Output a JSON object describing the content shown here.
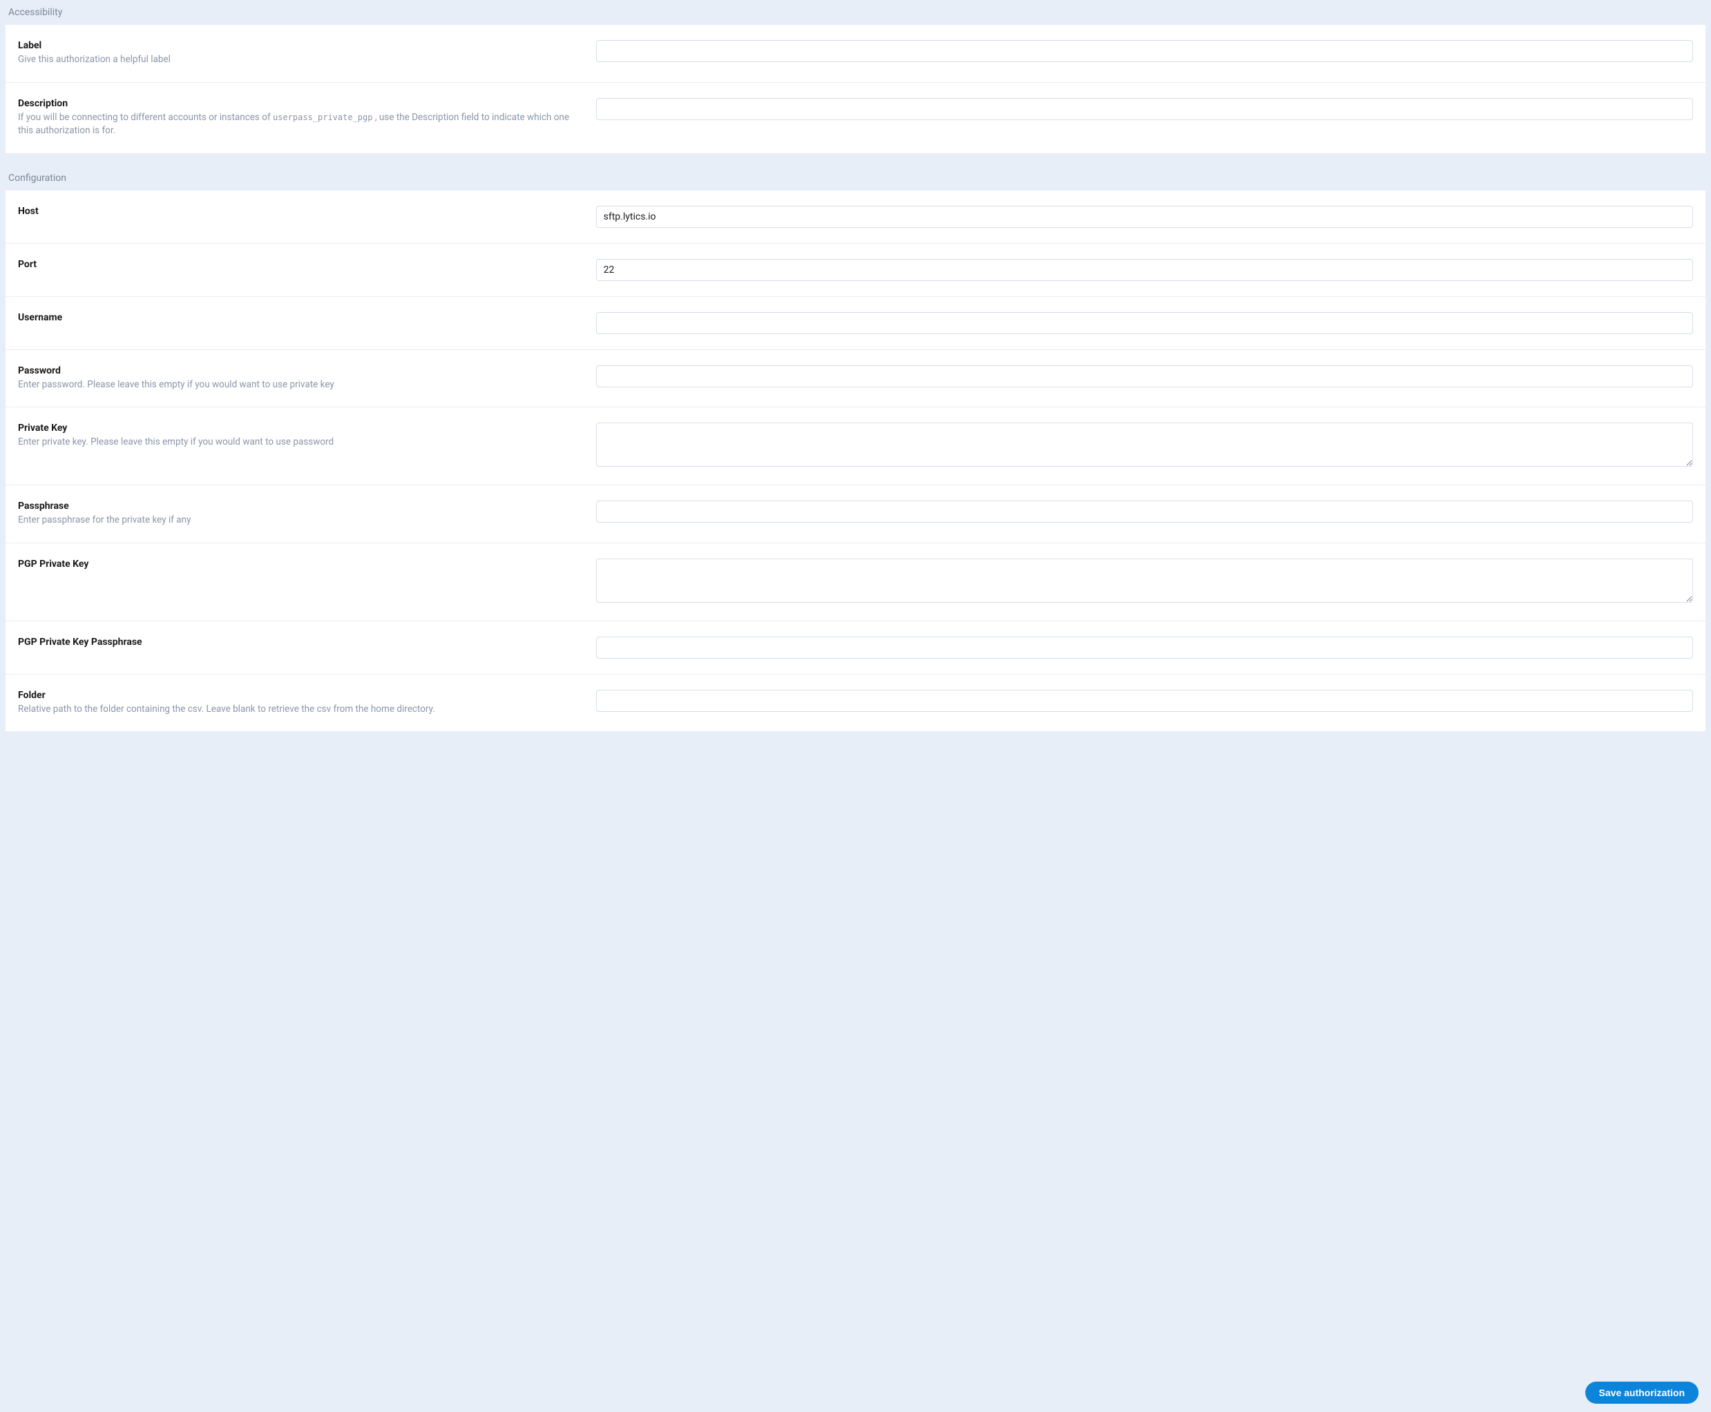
{
  "sections": {
    "accessibility": {
      "title": "Accessibility",
      "label": {
        "label": "Label",
        "help": "Give this authorization a helpful label",
        "value": ""
      },
      "description": {
        "label": "Description",
        "help_prefix": "If you will be connecting to different accounts or instances of ",
        "help_code": "userpass_private_pgp",
        "help_suffix": " , use the Description field to indicate which one this authorization is for.",
        "value": ""
      }
    },
    "configuration": {
      "title": "Configuration",
      "host": {
        "label": "Host",
        "value": "sftp.lytics.io"
      },
      "port": {
        "label": "Port",
        "value": "22"
      },
      "username": {
        "label": "Username",
        "value": ""
      },
      "password": {
        "label": "Password",
        "help": "Enter password. Please leave this empty if you would want to use private key",
        "value": ""
      },
      "private_key": {
        "label": "Private Key",
        "help": "Enter private key. Please leave this empty if you would want to use password",
        "value": ""
      },
      "passphrase": {
        "label": "Passphrase",
        "help": "Enter passphrase for the private key if any",
        "value": ""
      },
      "pgp_private_key": {
        "label": "PGP Private Key",
        "value": ""
      },
      "pgp_passphrase": {
        "label": "PGP Private Key Passphrase",
        "value": ""
      },
      "folder": {
        "label": "Folder",
        "help": "Relative path to the folder containing the csv. Leave blank to retrieve the csv from the home directory.",
        "value": ""
      }
    }
  },
  "actions": {
    "save": "Save authorization"
  }
}
